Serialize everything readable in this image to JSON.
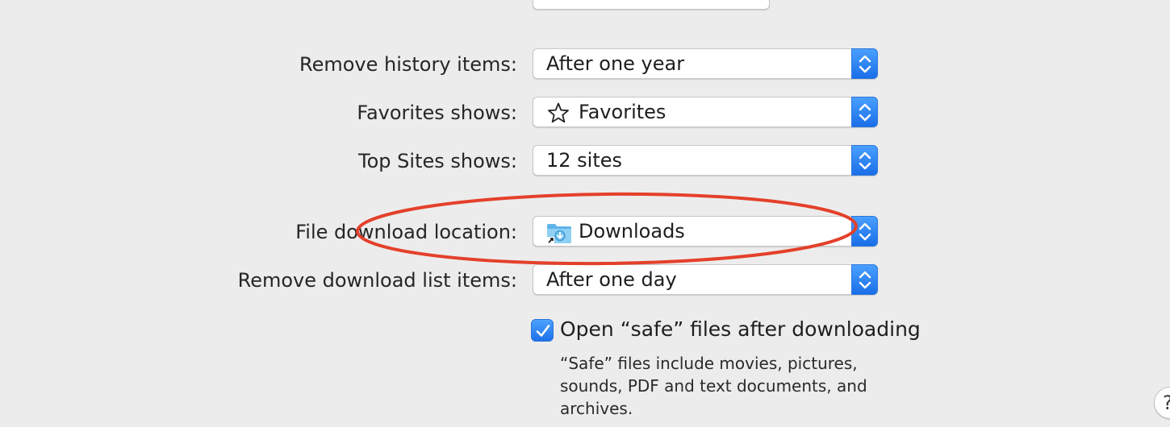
{
  "preferences": {
    "remove_history": {
      "label": "Remove history items:",
      "value": "After one year"
    },
    "favorites_shows": {
      "label": "Favorites shows:",
      "value": "Favorites",
      "icon": "star-icon"
    },
    "top_sites_shows": {
      "label": "Top Sites shows:",
      "value": "12 sites"
    },
    "download_location": {
      "label": "File download location:",
      "value": "Downloads",
      "icon": "downloads-folder-icon"
    },
    "remove_download_list": {
      "label": "Remove download list items:",
      "value": "After one day"
    },
    "open_safe_files": {
      "label": "Open “safe” files after downloading",
      "checked": true,
      "help": "“Safe” files include movies, pictures, sounds, PDF and text documents, and archives."
    },
    "help_button": {
      "label": "?"
    }
  },
  "colors": {
    "accent": "#1a6ee8",
    "annotation": "#e4402a",
    "background": "#ececec"
  }
}
